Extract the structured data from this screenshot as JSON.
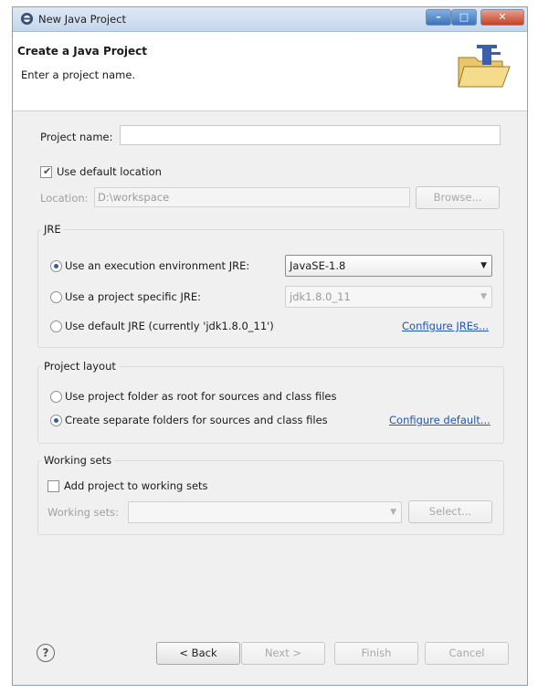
{
  "window": {
    "title": "New Java Project",
    "min": "–",
    "max": "□",
    "close": "✕"
  },
  "header": {
    "title": "Create a Java Project",
    "subtitle": "Enter a project name."
  },
  "project_name": {
    "label": "Project name:",
    "value": ""
  },
  "default_location": {
    "label": "Use default location",
    "checked": true
  },
  "location": {
    "label": "Location:",
    "value": "D:\\workspace",
    "browse": "Browse..."
  },
  "jre": {
    "group_title": "JRE",
    "option_env": "Use an execution environment JRE:",
    "env_value": "JavaSE-1.8",
    "option_specific": "Use a project specific JRE:",
    "specific_value": "jdk1.8.0_11",
    "option_default": "Use default JRE (currently 'jdk1.8.0_11')",
    "configure_link": "Configure JREs..."
  },
  "layout": {
    "group_title": "Project layout",
    "option_root": "Use project folder as root for sources and class files",
    "option_separate": "Create separate folders for sources and class files",
    "configure_link": "Configure default..."
  },
  "working_sets": {
    "group_title": "Working sets",
    "add_label": "Add project to working sets",
    "sets_label": "Working sets:",
    "select": "Select..."
  },
  "footer": {
    "help": "?",
    "back": "< Back",
    "next": "Next >",
    "finish": "Finish",
    "cancel": "Cancel"
  }
}
